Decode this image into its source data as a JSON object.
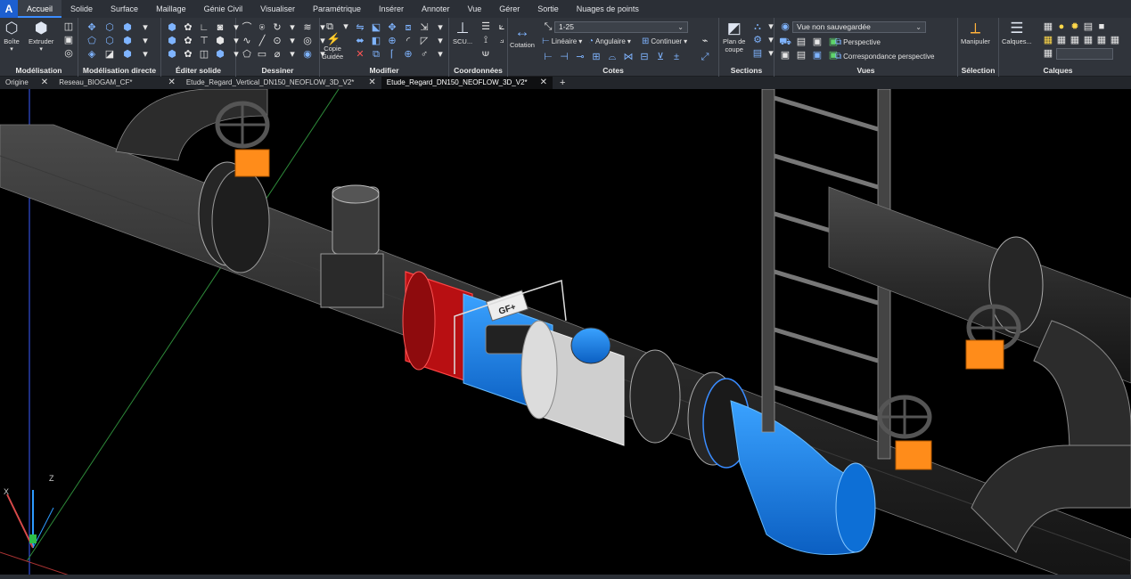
{
  "app": {
    "logo": "A"
  },
  "menu": {
    "tabs": [
      "Accueil",
      "Solide",
      "Surface",
      "Maillage",
      "Génie Civil",
      "Visualiser",
      "Paramétrique",
      "Insérer",
      "Annoter",
      "Vue",
      "Gérer",
      "Sortie",
      "Nuages de points"
    ],
    "active": "Accueil"
  },
  "ribbon": {
    "modelisation": {
      "title": "Modélisation",
      "box_label": "Boîte",
      "extrude_label": "Extruder"
    },
    "modelisation_directe": {
      "title": "Modélisation directe"
    },
    "editer_solide": {
      "title": "Éditer solide"
    },
    "dessiner": {
      "title": "Dessiner"
    },
    "modifier": {
      "title": "Modifier",
      "copy_guided_label_1": "Copie",
      "copy_guided_label_2": "Guidée"
    },
    "coordonnees": {
      "title": "Coordonnées",
      "scu_label": "SCU..."
    },
    "cotes": {
      "title": "Cotes",
      "cotation_label": "Cotation",
      "scale_value": "1-25",
      "lineaire_label": "Linéaire",
      "angulaire_label": "Angulaire",
      "continuer_label": "Continuer"
    },
    "sections": {
      "title": "Sections",
      "plan_label_1": "Plan de",
      "plan_label_2": "coupe"
    },
    "vues": {
      "title": "Vues",
      "view_value": "Vue non sauvegardée",
      "perspective_label": "Perspective",
      "correspondance_label": "Correspondance perspective"
    },
    "selection": {
      "title": "Sélection",
      "manipuler_label": "Manipuler"
    },
    "calques": {
      "title": "Calques",
      "calques_label": "Calques..."
    }
  },
  "file_tabs": {
    "items": [
      {
        "label": "Origine",
        "active": false
      },
      {
        "label": "Reseau_BIOGAM_CF*",
        "active": false
      },
      {
        "label": "Etude_Regard_Vertical_DN150_NEOFLOW_3D_V2*",
        "active": false
      },
      {
        "label": "Etude_Regard_DN150_NEOFLOW_3D_V2*",
        "active": true
      }
    ],
    "close_glyph": "✕",
    "add_glyph": "+"
  },
  "viewport": {
    "axis_x_label": "X",
    "axis_z_label": "Z",
    "valve_label": "GF+",
    "colors": {
      "background": "#000000",
      "pipe": "#2e2e2e",
      "pipe_edge": "#8a8a8a",
      "flow_meter_red": "#b80f12",
      "flow_meter_blue": "#1a8cff",
      "flow_meter_white": "#cfcfcf",
      "handwheel_orange": "#ff8c1a",
      "ladder": "#4a4a4a"
    }
  }
}
